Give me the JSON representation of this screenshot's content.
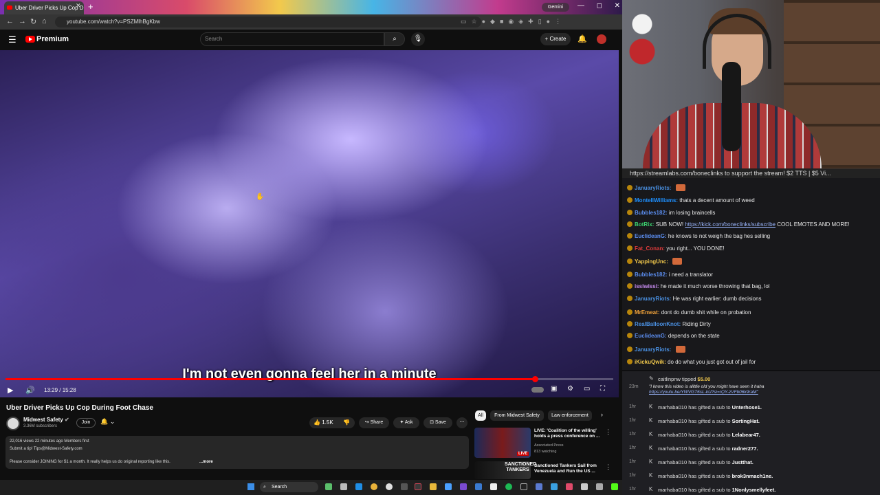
{
  "browser": {
    "tab_title": "Uber Driver Picks Up Cop Durin",
    "new_tab": "+",
    "gemini": "Gemini",
    "url": "youtube.com/watch?v=PSZMlhBgKbw",
    "window_controls": [
      "—",
      "◻",
      "✕"
    ]
  },
  "youtube": {
    "logo_text": "Premium",
    "search_placeholder": "Search",
    "create_label": "Create"
  },
  "player": {
    "subtitle": "I'm not even gonna feel her in a minute",
    "time": "13:29 / 15:28",
    "progress_fraction": 0.871
  },
  "video": {
    "title": "Uber Driver Picks Up Cop During Foot Chase",
    "channel": "Midwest Safety",
    "subscribers": "3.36M subscribers",
    "join": "Join",
    "likes": "1.5K",
    "share": "Share",
    "ask": "Ask",
    "save": "Save",
    "more": "⋯",
    "desc_meta": "22,016 views  22 minutes ago  Members first",
    "desc_line1": "Submit a tip! Tips@Midwest-Safety.com",
    "desc_line2": "Please consider JOINING for $1 a month. It really helps us do original reporting like this.",
    "desc_more": "...more"
  },
  "recommendations": {
    "chips": [
      "All",
      "From Midwest Safety",
      "Law enforcement"
    ],
    "items": [
      {
        "title": "LIVE: 'Coalition of the willing' holds a press conference on ...",
        "channel": "Associated Press",
        "meta": "813 watching",
        "badge": "LIVE"
      },
      {
        "title": "Sanctioned Tankers Sail from Venezuela and Run the US ...",
        "channel": "",
        "meta": "",
        "badge": ""
      }
    ],
    "thumb_text": [
      "SANCTIONED",
      "TANKERS"
    ]
  },
  "taskbar": {
    "search": "Search"
  },
  "chat": {
    "banner": "https://streamlabs.com/boneclinks  to support the stream! $2 TTS | $5 Vi...",
    "messages": [
      {
        "user": "JanuaryRiots:",
        "text": "",
        "color": "#4a90e2"
      },
      {
        "user": "MontellWilliams:",
        "text": "thats a decent amount of weed",
        "color": "#1e90ff"
      },
      {
        "user": "Bubbles182:",
        "text": "im losing braincells",
        "color": "#5b8def"
      },
      {
        "user": "BotRix:",
        "text": "SUB NOW! ",
        "link": "https://kick.com/boneclinks/subscribe",
        "tail": " COOL EMOTES AND MORE!",
        "color": "#3bd16f"
      },
      {
        "user": "EuclideanG:",
        "text": "he knows to not weigh the bag hes selling",
        "color": "#5b8def"
      },
      {
        "user": "Fat_Conan:",
        "text": "you right... YOU DONE!",
        "color": "#e23b3b"
      },
      {
        "user": "YappingUnc:",
        "text": "",
        "color": "#f2c94c"
      },
      {
        "user": "Bubbles182:",
        "text": "i need a translator",
        "color": "#5b8def"
      },
      {
        "user": "issiwissi:",
        "text": "he made it much worse throwing that bag, lol",
        "color": "#c78bf0"
      },
      {
        "user": "JanuaryRiots:",
        "text": "He was right earlier: dumb decisions",
        "color": "#4a90e2"
      },
      {
        "user": "MrEmeat:",
        "text": "dont do dumb shit while on probation",
        "color": "#f2a33a"
      },
      {
        "user": "RealBalloonKnot:",
        "text": "Riding Dirty",
        "color": "#4a90e2"
      },
      {
        "user": "EuclideanG:",
        "text": "depends on the state",
        "color": "#5b8def"
      },
      {
        "user": "JanuaryRiots:",
        "text": "",
        "color": "#4a90e2"
      },
      {
        "user": "iKickuQwik:",
        "text": "do do what you just got out of jail for",
        "color": "#f2c94c"
      }
    ]
  },
  "events": {
    "tip": {
      "time": "23m",
      "user": "caitlinpnw tipped",
      "amount": "$5.00",
      "message": "\"I know this video is alittle old you might have seen it haha",
      "link": "https://youtu.be/YWVGT6sL-kU?si=rQY-zVFb06k9raM\""
    },
    "subs": [
      {
        "time": "1hr",
        "text": "marhaba010 has gifted a sub to",
        "target": "Unterhose1."
      },
      {
        "time": "1hr",
        "text": "marhaba010 has gifted a sub to",
        "target": "SortingHat."
      },
      {
        "time": "1hr",
        "text": "marhaba010 has gifted a sub to",
        "target": "Lelabear47."
      },
      {
        "time": "1hr",
        "text": "marhaba010 has gifted a sub to",
        "target": "radner277."
      },
      {
        "time": "1hr",
        "text": "marhaba010 has gifted a sub to",
        "target": "Justthat."
      },
      {
        "time": "1hr",
        "text": "marhaba010 has gifted a sub to",
        "target": "brok3nmach1ne."
      },
      {
        "time": "1hr",
        "text": "marhaba010 has gifted a sub to",
        "target": "1Nonlysmellyfeet."
      }
    ]
  }
}
